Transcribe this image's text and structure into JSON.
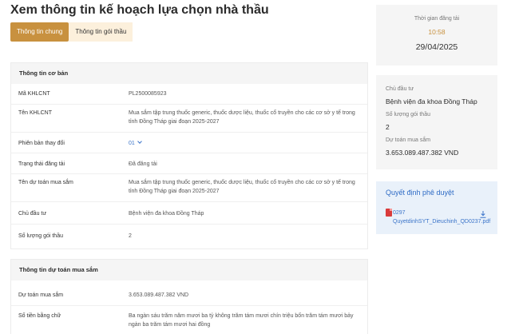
{
  "page": {
    "title": "Xem thông tin kế hoạch lựa chọn nhà thầu"
  },
  "tabs": [
    {
      "label": "Thông tin chung",
      "active": true
    },
    {
      "label": "Thông tin gói thầu",
      "active": false
    }
  ],
  "basic": {
    "header": "Thông tin cơ bản",
    "rows": [
      {
        "label": "Mã KHLCNT",
        "value": "PL2500085923"
      },
      {
        "label": "Tên KHLCNT",
        "value": "Mua sắm tập trung thuốc generic, thuốc dược liệu, thuốc cổ truyền cho các cơ sở y tế trong tỉnh Đồng Tháp giai đoạn 2025-2027"
      },
      {
        "label": "Phiên bản thay đổi",
        "value": "01"
      },
      {
        "label": "Trạng thái đăng tải",
        "value": "Đã đăng tải"
      },
      {
        "label": "Tên dự toán mua sắm",
        "value": "Mua sắm tập trung thuốc generic, thuốc dược liệu, thuốc cổ truyền cho các cơ sở y tế trong tỉnh Đồng Tháp giai đoạn 2025-2027"
      },
      {
        "label": "Chủ đầu tư",
        "value": "Bệnh viện đa khoa Đồng Tháp"
      },
      {
        "label": "Số lượng gói thầu",
        "value": "2"
      }
    ]
  },
  "estimate": {
    "header": "Thông tin dự toán mua sắm",
    "rows": [
      {
        "label": "Dự toán mua sắm",
        "value": "3.653.089.487.382 VND"
      },
      {
        "label": "Số tiền bằng chữ",
        "value": "Ba ngàn sáu trăm năm mươi ba tỷ không trăm tám mươi chín triệu bốn trăm tám mươi bảy ngàn ba trăm tám mươi hai đồng"
      }
    ]
  },
  "sidebar": {
    "posted": {
      "label": "Thời gian đăng tải",
      "time": "10:58",
      "date": "29/04/2025"
    },
    "summary": {
      "investor_label": "Chủ đầu tư",
      "investor_value": "Bệnh viện đa khoa Đồng Tháp",
      "packages_label": "Số lượng gói thầu",
      "packages_value": "2",
      "budget_label": "Dự toán mua sắm",
      "budget_value": "3.653.089.487.382 VND"
    },
    "decision": {
      "title": "Quyết định phê duyệt",
      "file": "0297 QuyetdinhSYT_Dieuchinh_QD0237.pdf",
      "file_icon": "pdf-file-icon",
      "download_icon": "download-icon"
    }
  },
  "colors": {
    "accent": "#c8913f",
    "tab_inactive": "#fcf0dc",
    "link": "#3b74c9",
    "panel": "#f5f5f5",
    "decision_bg": "#e9f1fa"
  }
}
